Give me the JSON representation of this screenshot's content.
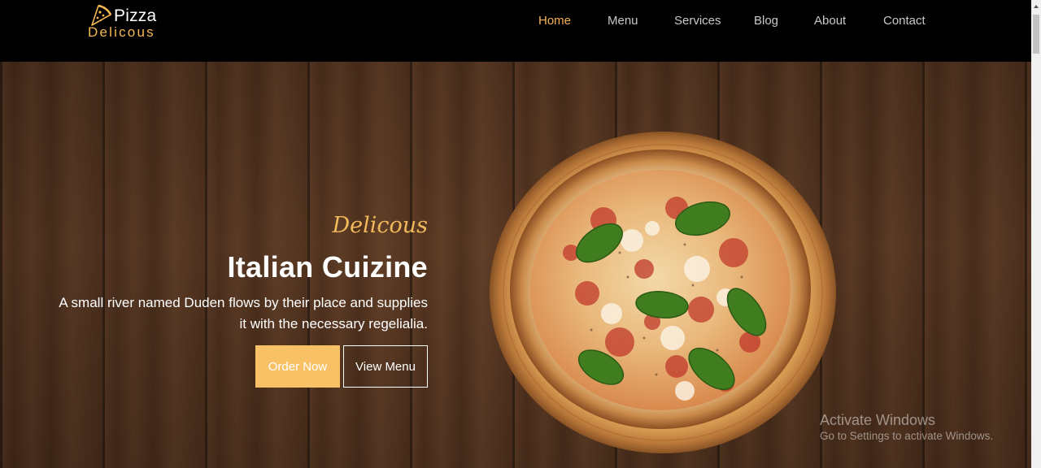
{
  "brand": {
    "top": "Pizza",
    "bottom": "Delicous",
    "icon": "pizza-slice-icon",
    "accent_color": "#f6b94f"
  },
  "nav": {
    "items": [
      {
        "label": "Home",
        "active": true
      },
      {
        "label": "Menu",
        "active": false
      },
      {
        "label": "Services",
        "active": false
      },
      {
        "label": "Blog",
        "active": false
      },
      {
        "label": "About",
        "active": false
      },
      {
        "label": "Contact",
        "active": false
      }
    ],
    "active_color": "#f7b250",
    "text_color": "#c8c8c8"
  },
  "hero": {
    "subheading": "Delicous",
    "heading": "Italian Cuizine",
    "description": "A small river named Duden flows by their place and supplies it with the necessary regelialia.",
    "order_button": "Order Now",
    "view_button": "View Menu",
    "button_color": "#f8c166",
    "image": "pizza-on-wooden-board"
  },
  "watermark": {
    "title": "Activate Windows",
    "subtitle": "Go to Settings to activate Windows."
  }
}
